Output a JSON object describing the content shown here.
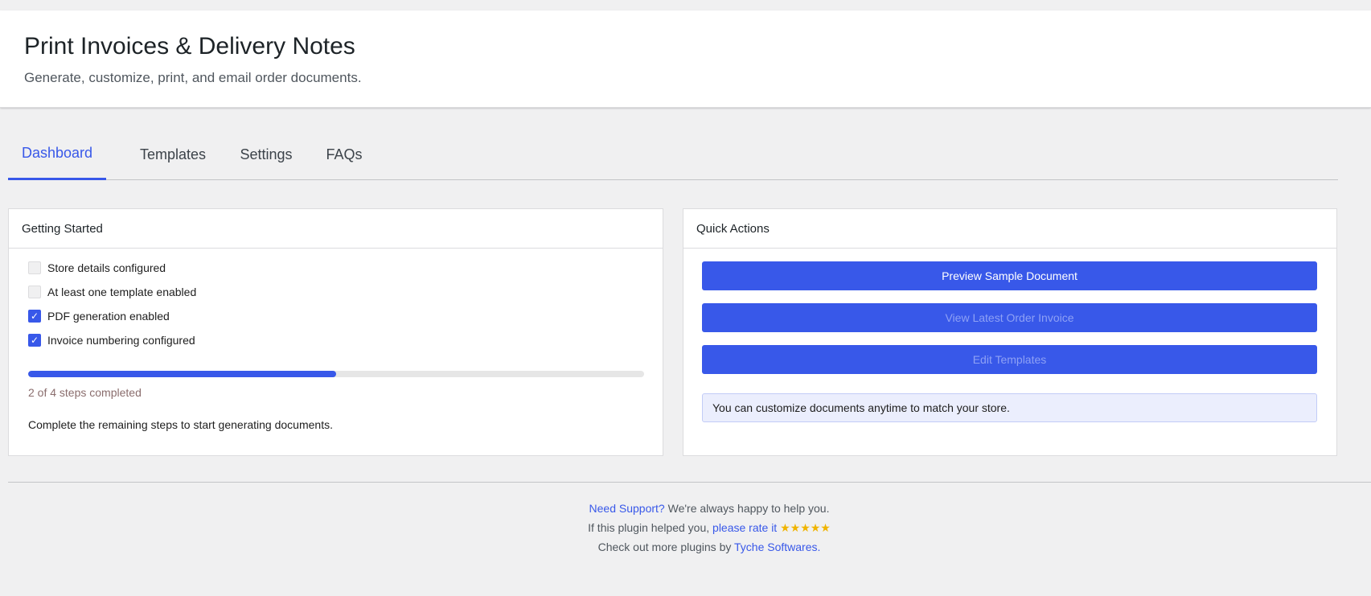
{
  "header": {
    "title": "Print Invoices & Delivery Notes",
    "subtitle": "Generate, customize, print, and email order documents."
  },
  "tabs": [
    {
      "label": "Dashboard",
      "active": true
    },
    {
      "label": "Templates",
      "active": false
    },
    {
      "label": "Settings",
      "active": false
    },
    {
      "label": "FAQs",
      "active": false
    }
  ],
  "getting_started": {
    "title": "Getting Started",
    "steps": [
      {
        "label": "Store details configured",
        "checked": false
      },
      {
        "label": "At least one template enabled",
        "checked": false
      },
      {
        "label": "PDF generation enabled",
        "checked": true
      },
      {
        "label": "Invoice numbering configured",
        "checked": true
      }
    ],
    "progress_fraction": 0.5,
    "progress_label": "2 of 4 steps completed",
    "note": "Complete the remaining steps to start generating documents."
  },
  "quick_actions": {
    "title": "Quick Actions",
    "buttons": [
      {
        "label": "Preview Sample Document",
        "enabled": true
      },
      {
        "label": "View Latest Order Invoice",
        "enabled": false
      },
      {
        "label": "Edit Templates",
        "enabled": false
      }
    ],
    "info": "You can customize documents anytime to match your store."
  },
  "footer": {
    "support_link": "Need Support?",
    "support_text": " We're always happy to help you.",
    "rate_prefix": "If this plugin helped you, ",
    "rate_link": "please rate it",
    "stars": "★★★★★",
    "more_prefix": "Check out more plugins by ",
    "more_link": "Tyche Softwares",
    "more_suffix": "."
  },
  "colors": {
    "accent": "#3858e9",
    "star": "#f0b400"
  }
}
